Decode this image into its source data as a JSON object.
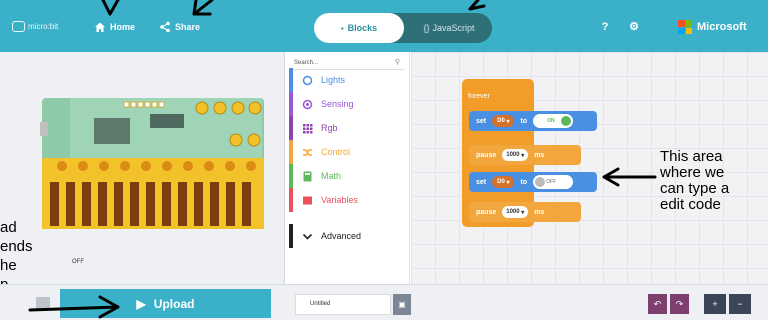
{
  "header": {
    "brand_text": "micro:bit",
    "home_label": "Home",
    "share_label": "Share",
    "blocks_label": "Blocks",
    "javascript_label": "JavaScript",
    "help_glyph": "?",
    "settings_glyph": "⚙",
    "microsoft_label": "Microsoft"
  },
  "simulator": {
    "off_label": "OFF",
    "buttons": [
      "■",
      "↻",
      "⧉",
      "✕"
    ]
  },
  "toolbox": {
    "search_placeholder": "Search...",
    "categories": [
      {
        "label": "Lights",
        "color": "#4a8fe2",
        "icon": "circle-icon"
      },
      {
        "label": "Sensing",
        "color": "#9b59d0",
        "icon": "target-icon"
      },
      {
        "label": "Rgb",
        "color": "#8e44ad",
        "icon": "grid-icon"
      },
      {
        "label": "Control",
        "color": "#f2a73e",
        "icon": "shuffle-icon"
      },
      {
        "label": "Math",
        "color": "#5cb85c",
        "icon": "calculator-icon"
      },
      {
        "label": "Variables",
        "color": "#e8505b",
        "icon": "list-icon"
      },
      {
        "label": "Advanced",
        "color": "#222222",
        "icon": "chevron-down-icon"
      }
    ]
  },
  "workspace": {
    "forever_label": "forever",
    "set_label": "set",
    "to_label": "to",
    "pause_label": "pause",
    "ms_label": "ms",
    "pin": "D0",
    "pause_value": "1000",
    "state_on": "ON",
    "state_off": "OFF"
  },
  "annotations": {
    "area_note": "This area\nwhere we\ncan type a\nedit code",
    "left_note": "ad\nends\nhe\np"
  },
  "bottombar": {
    "upload_label": "Upload",
    "project_name": "Untitled",
    "save_glyph": "▣",
    "undo_glyph": "↶",
    "redo_glyph": "↷",
    "zoom_in_glyph": "+",
    "zoom_out_glyph": "−"
  },
  "colors": {
    "accent": "#3ab0c9",
    "block_blue": "#4a90e2",
    "block_orange": "#f29d29",
    "board_yellow": "#f3c12a"
  }
}
